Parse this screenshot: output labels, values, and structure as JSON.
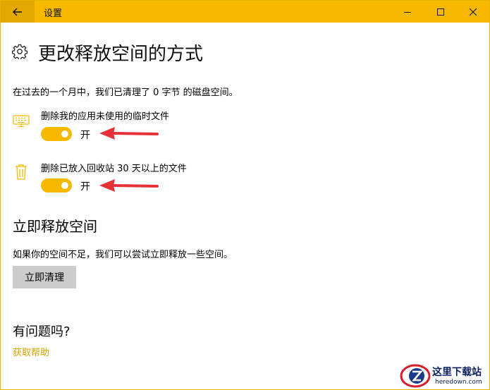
{
  "window": {
    "title": "设置",
    "back_icon": "arrow-left-icon",
    "controls": [
      "minimize-icon",
      "maximize-icon",
      "close-icon"
    ]
  },
  "page": {
    "title": "更改释放空间的方式",
    "title_icon": "gear-icon",
    "summary": "在过去的一个月中，我们已清理了 0 字节 的磁盘空间。"
  },
  "options": [
    {
      "icon": "keyboard-icon",
      "label": "删除我的应用未使用的临时文件",
      "state": "开",
      "on": true
    },
    {
      "icon": "trash-icon",
      "label": "删除已放入回收站 30 天以上的文件",
      "state": "开",
      "on": true
    }
  ],
  "free_now": {
    "title": "立即释放空间",
    "description": "如果你的空间不足，我们可以尝试立即释放一些空间。",
    "button_label": "立即清理"
  },
  "help": {
    "title": "有问题吗?",
    "link": "获取帮助"
  },
  "watermark": {
    "line1": "这里下载站",
    "line2": "heredown.com"
  },
  "colors": {
    "accent": "#f6b900",
    "arrow": "#e53238",
    "link": "#d4a300",
    "button_bg": "#cccccc"
  }
}
